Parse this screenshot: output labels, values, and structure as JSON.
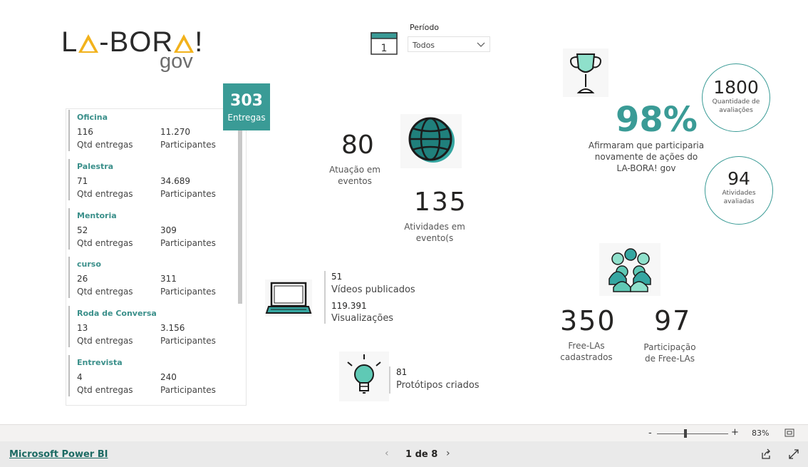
{
  "logo": {
    "main_left": "L",
    "main_right": "-BOR",
    "main_end": "!",
    "sub": "gov"
  },
  "filter": {
    "label": "Período",
    "selected": "Todos",
    "calendar_day": "1"
  },
  "entregas": {
    "total": "303",
    "label": "Entregas",
    "items": [
      {
        "type": "Oficina",
        "qtd": "116",
        "qtd_label": "Qtd entregas",
        "participantes": "11.270",
        "participantes_label": "Participantes"
      },
      {
        "type": "Palestra",
        "qtd": "71",
        "qtd_label": "Qtd entregas",
        "participantes": "34.689",
        "participantes_label": "Participantes"
      },
      {
        "type": "Mentoria",
        "qtd": "52",
        "qtd_label": "Qtd entregas",
        "participantes": "309",
        "participantes_label": "Participantes"
      },
      {
        "type": "curso",
        "qtd": "26",
        "qtd_label": "Qtd entregas",
        "participantes": "311",
        "participantes_label": "Participantes"
      },
      {
        "type": "Roda de Conversa",
        "qtd": "13",
        "qtd_label": "Qtd entregas",
        "participantes": "3.156",
        "participantes_label": "Participantes"
      },
      {
        "type": "Entrevista",
        "qtd": "4",
        "qtd_label": "Qtd entregas",
        "participantes": "240",
        "participantes_label": "Participantes"
      }
    ]
  },
  "kpis": {
    "eventos": {
      "value": "80",
      "label_1": "Atuação em",
      "label_2": "eventos"
    },
    "atividades_eventos": {
      "value": "135",
      "label_1": "Atividades em",
      "label_2": "evento(s"
    },
    "videos": {
      "value": "51",
      "label": "Vídeos publicados"
    },
    "visualizacoes": {
      "value": "119.391",
      "label": "Visualizações"
    },
    "prototipos": {
      "value": "81",
      "label": "Protótipos criados"
    },
    "satisfacao": {
      "value": "98%",
      "label_1": "Afirmaram que participaria",
      "label_2": "novamente de ações do",
      "label_3": "LA-BORA! gov"
    },
    "avaliacoes": {
      "value": "1800",
      "label_1": "Quantidade de",
      "label_2": "avaliações"
    },
    "atividades_avaliadas": {
      "value": "94",
      "label_1": "Atividades",
      "label_2": "avaliadas"
    },
    "free_las": {
      "value": "350",
      "label_1": "Free-LAs",
      "label_2": "cadastrados"
    },
    "participacao_free_las": {
      "value": "97",
      "label_1": "Participação",
      "label_2": "de Free-LAs"
    }
  },
  "zoom": {
    "minus": "-",
    "plus": "+",
    "value": "83%"
  },
  "footer": {
    "link": "Microsoft Power BI",
    "page_indicator": "1 de 8",
    "prev": "‹",
    "next": "›"
  },
  "colors": {
    "teal": "#3a9b96",
    "teal_light": "#5fc9b5",
    "yellow": "#f2b21c"
  }
}
